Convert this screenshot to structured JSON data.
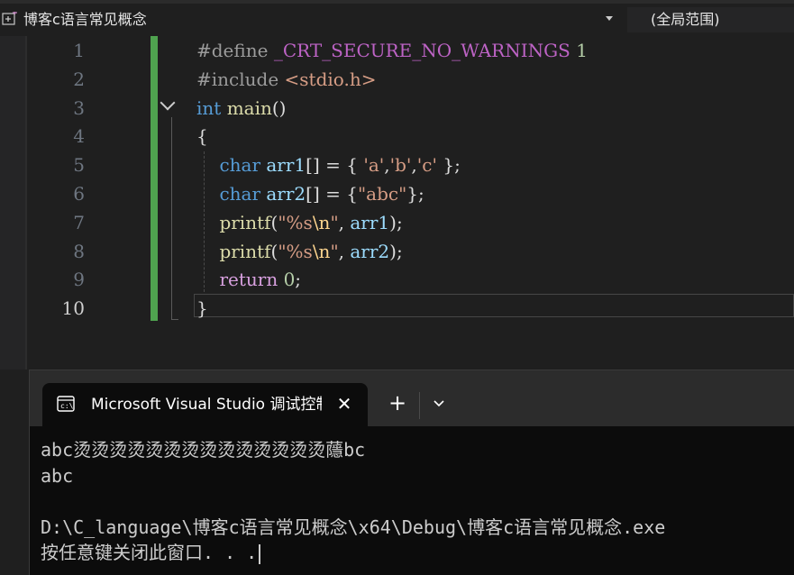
{
  "navbar": {
    "project": "博客c语言常见概念",
    "scope": "(全局范围)"
  },
  "editor": {
    "line_numbers": [
      "1",
      "2",
      "3",
      "4",
      "5",
      "6",
      "7",
      "8",
      "9",
      "10"
    ],
    "lines": [
      [
        {
          "t": "#define ",
          "c": "pp"
        },
        {
          "t": "_CRT_SECURE_NO_WARNINGS",
          "c": "mac"
        },
        {
          "t": " ",
          "c": ""
        },
        {
          "t": "1",
          "c": "num"
        }
      ],
      [
        {
          "t": "#include ",
          "c": "pp"
        },
        {
          "t": "<stdio.h>",
          "c": "str"
        }
      ],
      [
        {
          "t": "int",
          "c": "kw"
        },
        {
          "t": " ",
          "c": ""
        },
        {
          "t": "main",
          "c": "fn"
        },
        {
          "t": "()",
          "c": ""
        }
      ],
      [
        {
          "t": "{",
          "c": ""
        }
      ],
      [
        {
          "t": "    ",
          "c": ""
        },
        {
          "t": "char",
          "c": "kw"
        },
        {
          "t": " ",
          "c": ""
        },
        {
          "t": "arr1",
          "c": "var"
        },
        {
          "t": "[] = { ",
          "c": ""
        },
        {
          "t": "'a'",
          "c": "str"
        },
        {
          "t": ",",
          "c": ""
        },
        {
          "t": "'b'",
          "c": "str"
        },
        {
          "t": ",",
          "c": ""
        },
        {
          "t": "'c'",
          "c": "str"
        },
        {
          "t": " };",
          "c": ""
        }
      ],
      [
        {
          "t": "    ",
          "c": ""
        },
        {
          "t": "char",
          "c": "kw"
        },
        {
          "t": " ",
          "c": ""
        },
        {
          "t": "arr2",
          "c": "var"
        },
        {
          "t": "[] = {",
          "c": ""
        },
        {
          "t": "\"abc\"",
          "c": "str"
        },
        {
          "t": "};",
          "c": ""
        }
      ],
      [
        {
          "t": "    ",
          "c": ""
        },
        {
          "t": "printf",
          "c": "fn"
        },
        {
          "t": "(",
          "c": ""
        },
        {
          "t": "\"%s",
          "c": "str"
        },
        {
          "t": "\\n",
          "c": "esc"
        },
        {
          "t": "\"",
          "c": "str"
        },
        {
          "t": ", ",
          "c": ""
        },
        {
          "t": "arr1",
          "c": "var"
        },
        {
          "t": ");",
          "c": ""
        }
      ],
      [
        {
          "t": "    ",
          "c": ""
        },
        {
          "t": "printf",
          "c": "fn"
        },
        {
          "t": "(",
          "c": ""
        },
        {
          "t": "\"%s",
          "c": "str"
        },
        {
          "t": "\\n",
          "c": "esc"
        },
        {
          "t": "\"",
          "c": "str"
        },
        {
          "t": ", ",
          "c": ""
        },
        {
          "t": "arr2",
          "c": "var"
        },
        {
          "t": ");",
          "c": ""
        }
      ],
      [
        {
          "t": "    ",
          "c": ""
        },
        {
          "t": "return",
          "c": "ctl"
        },
        {
          "t": " ",
          "c": ""
        },
        {
          "t": "0",
          "c": "num"
        },
        {
          "t": ";",
          "c": ""
        }
      ],
      [
        {
          "t": "}",
          "c": ""
        }
      ]
    ]
  },
  "terminal": {
    "tab_title": "Microsoft Visual Studio 调试控制台",
    "close_glyph": "✕",
    "new_tab_glyph": "+",
    "output": [
      "abc烫烫烫烫烫烫烫烫烫烫烫烫烫烫蘟bc",
      "abc",
      "",
      "D:\\C_language\\博客c语言常见概念\\x64\\Debug\\博客c语言常见概念.exe",
      "按任意键关闭此窗口. . ."
    ]
  },
  "colors": {
    "change_bar": "#4fa34f",
    "keyword": "#569cd6",
    "string": "#d69d85",
    "function": "#dcdcaa",
    "variable": "#9cdcfe"
  },
  "icons": {
    "project": "cpp-project-icon",
    "dropdown": "chevron-down-icon",
    "fold": "collapse-chevron-icon",
    "terminal": "console-icon",
    "close": "close-icon",
    "add": "plus-icon"
  }
}
